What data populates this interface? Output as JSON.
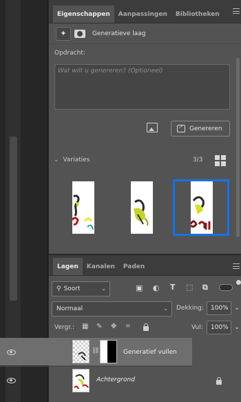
{
  "properties_panel": {
    "tabs": [
      "Eigenschappen",
      "Aanpassingen",
      "Bibliotheken"
    ],
    "active_tab": "Eigenschappen",
    "layer_type_label": "Generatieve laag",
    "prompt_label": "Opdracht:",
    "prompt_placeholder": "Wat wilt u genereren? (Optioneel)",
    "generate_button": "Genereren",
    "variations_label": "Variaties",
    "variations_count": "3/3",
    "selected_variation": 3
  },
  "layers_panel": {
    "tabs": [
      "Lagen",
      "Kanalen",
      "Paden"
    ],
    "active_tab": "Lagen",
    "filter_select": "Soort",
    "blend_mode": "Normaal",
    "opacity_label": "Dekking:",
    "opacity_value": "100%",
    "lock_label": "Vergr.:",
    "fill_label": "Vul:",
    "fill_value": "100%",
    "layers": [
      {
        "name": "Generatief vullen",
        "selected": true
      },
      {
        "name": "Achtergrond",
        "locked": true
      }
    ]
  },
  "colors": {
    "accent": "#1473e6",
    "panel": "#535353",
    "tabbar": "#3c3c3c"
  }
}
